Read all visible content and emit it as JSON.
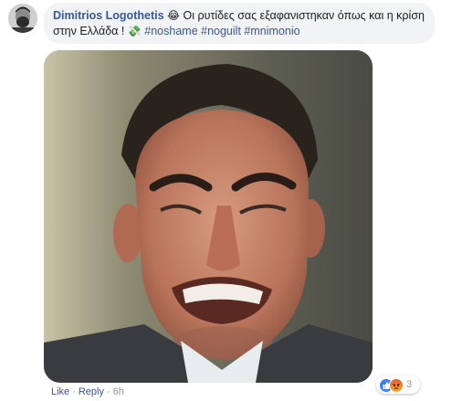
{
  "comment": {
    "author": "Dimitrios Logothetis",
    "emoji": "😂",
    "text": "Οι ρυτίδες σας εξαφανιστηκαν όπως και η κρίση στην Ελλάδα !",
    "emoji2": "💸",
    "hashtags": [
      "#noshame",
      "#noguilt",
      "#mnimonio"
    ]
  },
  "actions": {
    "like": "Like",
    "sep": "·",
    "reply": "Reply",
    "time": "6h"
  },
  "reactions": {
    "types": [
      "like-icon",
      "angry-icon"
    ],
    "count": "3"
  },
  "colors": {
    "link": "#385898",
    "bubble": "#f2f3f5",
    "meta": "#90949c"
  }
}
